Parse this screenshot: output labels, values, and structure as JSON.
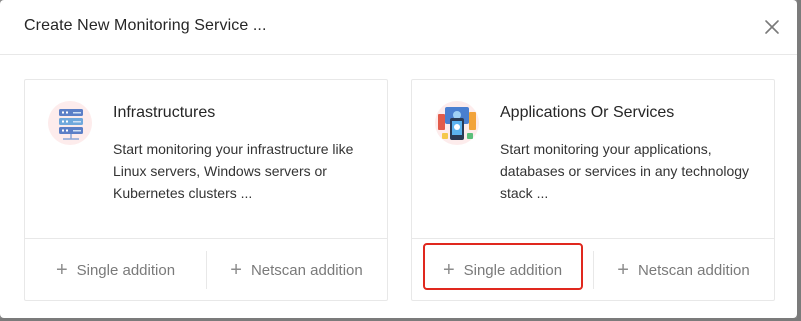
{
  "modal": {
    "title": "Create New Monitoring Service ...",
    "close_icon": "close-icon"
  },
  "cards": [
    {
      "icon": "server-rack-icon",
      "title": "Infrastructures",
      "description": "Start monitoring your infrastructure like Linux servers, Windows servers or Kubernetes clusters ...",
      "actions": [
        {
          "icon": "plus-icon",
          "label": "Single addition"
        },
        {
          "icon": "plus-icon",
          "label": "Netscan addition"
        }
      ]
    },
    {
      "icon": "applications-icon",
      "title": "Applications Or Services",
      "description": "Start monitoring your applications, databases or services in any technology stack ...",
      "actions": [
        {
          "icon": "plus-icon",
          "label": "Single addition"
        },
        {
          "icon": "plus-icon",
          "label": "Netscan addition"
        }
      ]
    }
  ],
  "colors": {
    "highlight": "#e0281e",
    "action_text": "#7a7a7a",
    "border": "#e8e8e8"
  }
}
